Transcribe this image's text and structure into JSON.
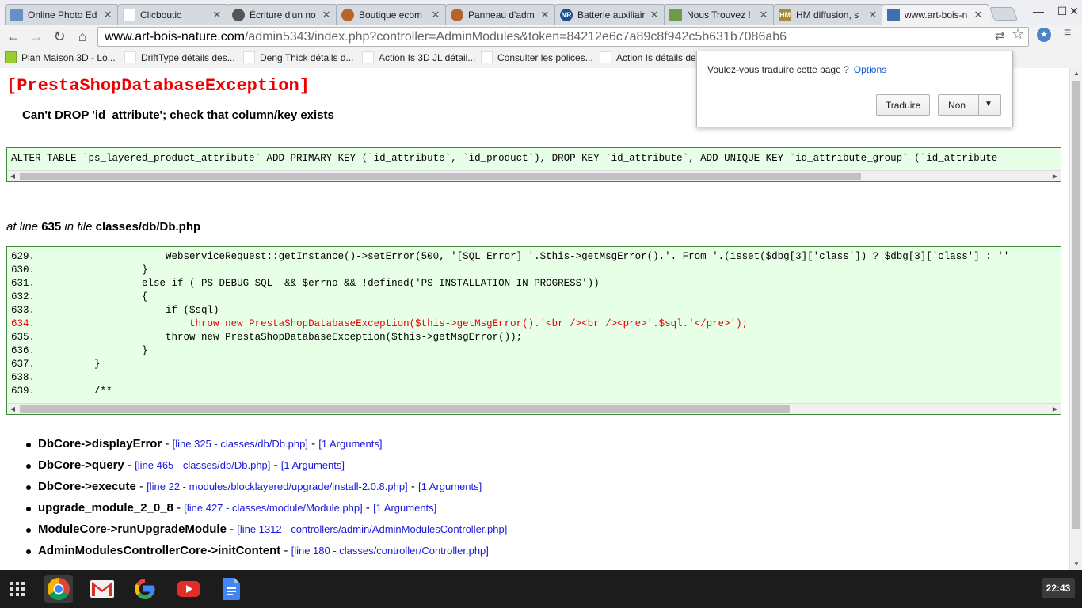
{
  "tabs": [
    {
      "title": "Online Photo Ed",
      "favicon_color": "#6a8fc7"
    },
    {
      "title": "Clicboutic",
      "favicon_color": "#dddddd"
    },
    {
      "title": "Écriture d'un no",
      "favicon_color": "#555555"
    },
    {
      "title": "Boutique ecom",
      "favicon_color": "#b5652a"
    },
    {
      "title": "Panneau d'adm",
      "favicon_color": "#b5652a"
    },
    {
      "title": "Batterie auxiliair",
      "favicon_color": "#1f4e8c"
    },
    {
      "title": "Nous Trouvez !",
      "favicon_color": "#6b9c4e"
    },
    {
      "title": "HM diffusion, s",
      "favicon_color": "#a68a3c"
    },
    {
      "title": "www.art-bois-n",
      "favicon_color": "#3c6fb5"
    }
  ],
  "address": {
    "host": "www.art-bois-nature.com",
    "path": "/admin5343/index.php?controller=AdminModules&token=84212e6c7a89c8f942c5b631b7086ab6"
  },
  "bookmarks": [
    "Plan Maison 3D - Lo...",
    "DriftType détails des...",
    "Deng Thick détails d...",
    "Action Is 3D JL détail...",
    "Consulter les polices...",
    "Action Is détails des"
  ],
  "translate": {
    "question": "Voulez-vous traduire cette page ?",
    "options_label": "Options",
    "translate_label": "Traduire",
    "no_label": "Non"
  },
  "error": {
    "title": "[PrestaShopDatabaseException]",
    "message": "Can't DROP 'id_attribute'; check that column/key exists",
    "sql": "ALTER TABLE `ps_layered_product_attribute` ADD PRIMARY KEY (`id_attribute`, `id_product`), DROP KEY `id_attribute`, ADD UNIQUE KEY `id_attribute_group` (`id_attribute",
    "at_line_prefix": "at line",
    "line": "635",
    "in_file_prefix": "in file",
    "file": "classes/db/Db.php"
  },
  "code_lines": [
    {
      "num": "629.",
      "code": "                WebserviceRequest::getInstance()->setError(500, '[SQL Error] '.$this->getMsgError().'. From '.(isset($dbg[3]['class']) ? $dbg[3]['class'] : ''",
      "highlight": false
    },
    {
      "num": "630.",
      "code": "            }",
      "highlight": false
    },
    {
      "num": "631.",
      "code": "            else if (_PS_DEBUG_SQL_ && $errno && !defined('PS_INSTALLATION_IN_PROGRESS'))",
      "highlight": false
    },
    {
      "num": "632.",
      "code": "            {",
      "highlight": false
    },
    {
      "num": "633.",
      "code": "                if ($sql)",
      "highlight": false
    },
    {
      "num": "634.",
      "code": "                    throw new PrestaShopDatabaseException($this->getMsgError().'<br /><br /><pre>'.$sql.'</pre>');",
      "highlight": true
    },
    {
      "num": "635.",
      "code": "                throw new PrestaShopDatabaseException($this->getMsgError());",
      "highlight": false
    },
    {
      "num": "636.",
      "code": "            }",
      "highlight": false
    },
    {
      "num": "637.",
      "code": "    }",
      "highlight": false
    },
    {
      "num": "638.",
      "code": "",
      "highlight": false
    },
    {
      "num": "639.",
      "code": "    /**",
      "highlight": false
    }
  ],
  "trace": [
    {
      "fn": "DbCore->displayError",
      "loc": "[line 325 - classes/db/Db.php]",
      "args": "[1 Arguments]"
    },
    {
      "fn": "DbCore->query",
      "loc": "[line 465 - classes/db/Db.php]",
      "args": "[1 Arguments]"
    },
    {
      "fn": "DbCore->execute",
      "loc": "[line 22 - modules/blocklayered/upgrade/install-2.0.8.php]",
      "args": "[1 Arguments]"
    },
    {
      "fn": "upgrade_module_2_0_8",
      "loc": "[line 427 - classes/module/Module.php]",
      "args": "[1 Arguments]"
    },
    {
      "fn": "ModuleCore->runUpgradeModule",
      "loc": "[line 1312 - controllers/admin/AdminModulesController.php]",
      "args": ""
    },
    {
      "fn": "AdminModulesControllerCore->initContent",
      "loc": "[line 180 - classes/controller/Controller.php]",
      "args": ""
    }
  ],
  "taskbar": {
    "apps": [
      "apps-launcher-icon",
      "chrome-icon",
      "gmail-icon",
      "google-icon",
      "youtube-icon",
      "docs-icon"
    ],
    "clock": "22:43"
  }
}
